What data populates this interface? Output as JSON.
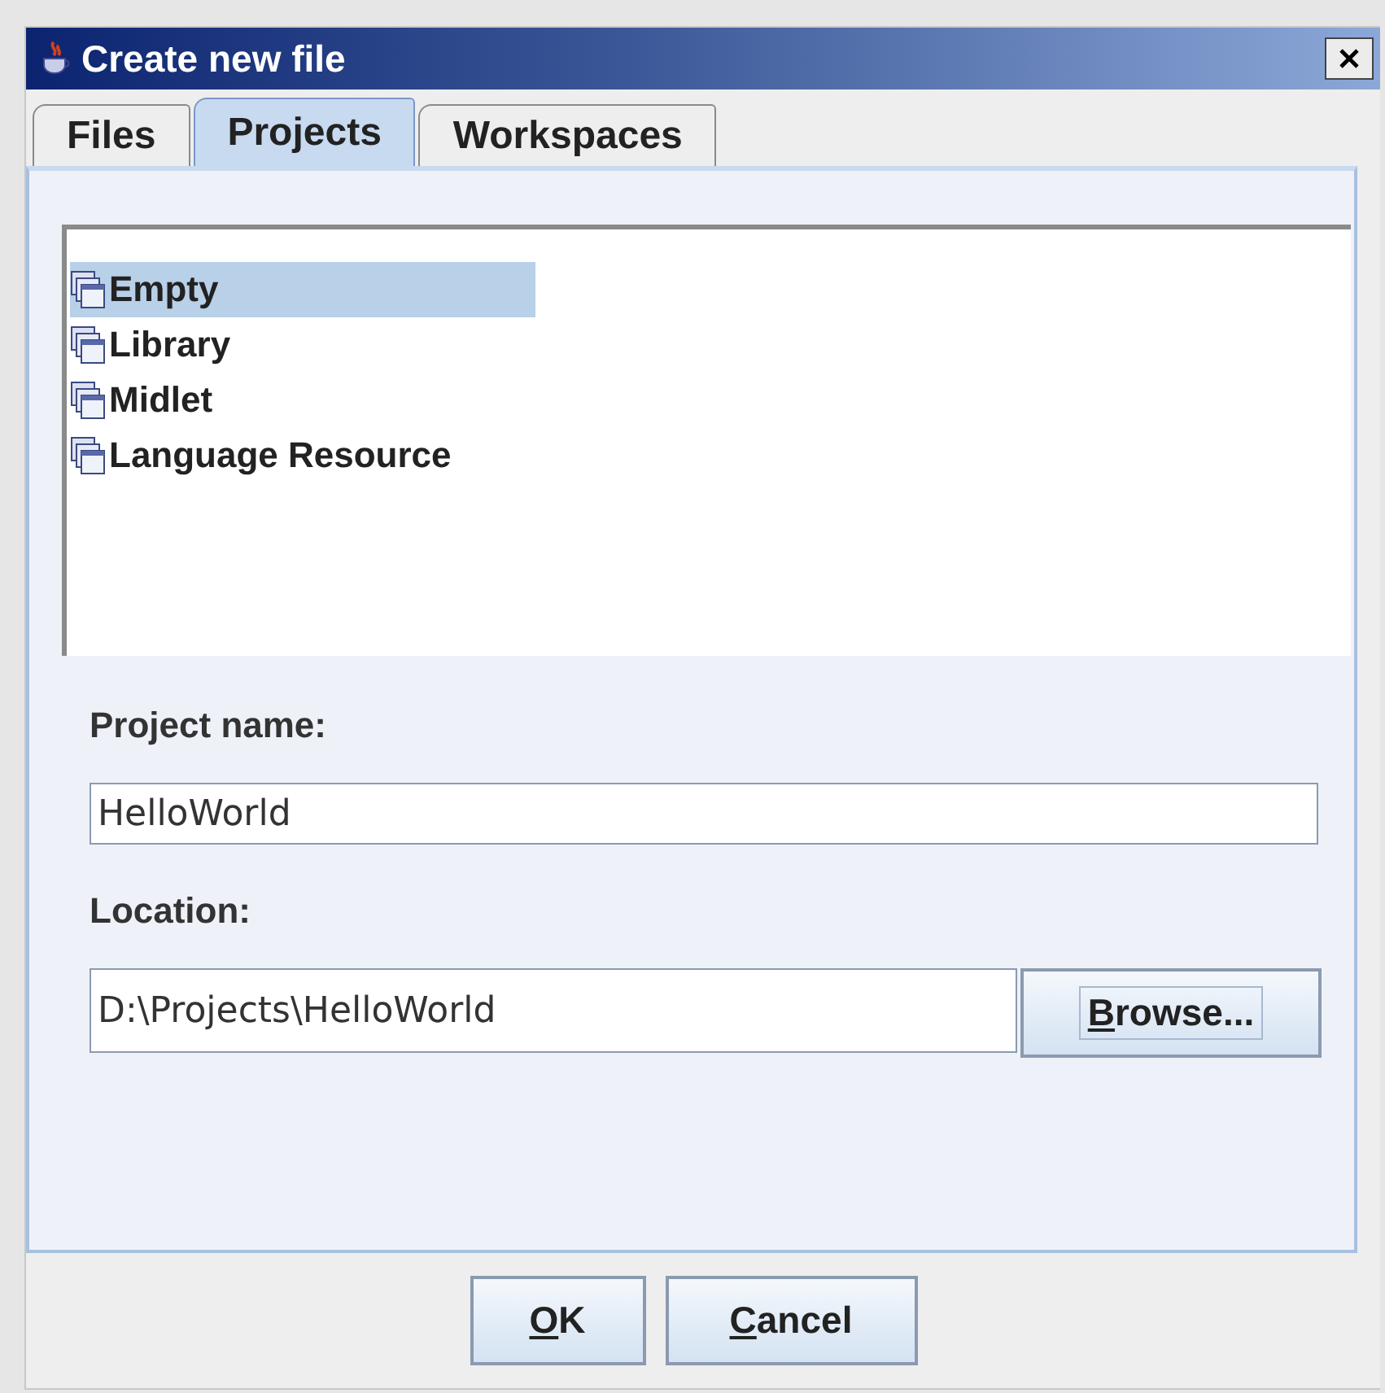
{
  "window": {
    "title": "Create new file"
  },
  "tabs": [
    {
      "label": "Files",
      "selected": false
    },
    {
      "label": "Projects",
      "selected": true
    },
    {
      "label": "Workspaces",
      "selected": false
    }
  ],
  "project_types": [
    {
      "label": "Empty",
      "selected": true
    },
    {
      "label": "Library",
      "selected": false
    },
    {
      "label": "Midlet",
      "selected": false
    },
    {
      "label": "Language Resource",
      "selected": false
    }
  ],
  "project_name": {
    "label": "Project name:",
    "value": "HelloWorld"
  },
  "location": {
    "label": "Location:",
    "value": "D:\\Projects\\HelloWorld",
    "button": "Browse..."
  },
  "buttons": [
    "OK",
    "Cancel"
  ]
}
